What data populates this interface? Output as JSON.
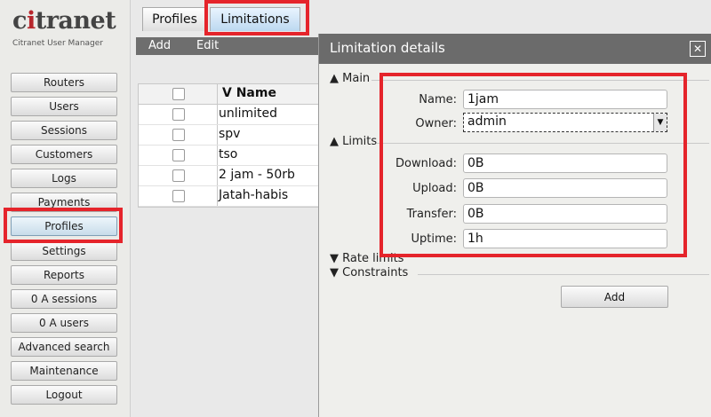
{
  "brand": {
    "logo_prefix": "c",
    "logo_accent": "i",
    "logo_suffix": "tranet",
    "subtitle": "Citranet User Manager"
  },
  "sidebar": {
    "items": [
      {
        "label": "Routers"
      },
      {
        "label": "Users"
      },
      {
        "label": "Sessions"
      },
      {
        "label": "Customers"
      },
      {
        "label": "Logs"
      },
      {
        "label": "Payments"
      },
      {
        "label": "Profiles",
        "active": true
      },
      {
        "label": "Settings"
      },
      {
        "label": "Reports"
      },
      {
        "label": "0 A sessions"
      },
      {
        "label": "0 A users"
      },
      {
        "label": "Advanced search"
      },
      {
        "label": "Maintenance"
      },
      {
        "label": "Logout"
      }
    ]
  },
  "tabs": [
    {
      "label": "Profiles"
    },
    {
      "label": "Limitations",
      "active": true
    }
  ],
  "toolbar": {
    "add_label": "Add",
    "edit_label": "Edit"
  },
  "list": {
    "header": "V Name",
    "rows": [
      "unlimited",
      "spv",
      "tso",
      "2 jam - 50rb",
      "Jatah-habis"
    ]
  },
  "dialog": {
    "title": "Limitation details",
    "close_icon": "close-icon",
    "main_section": "Main",
    "name_label": "Name:",
    "name_value": "1jam",
    "owner_label": "Owner:",
    "owner_value": "admin",
    "limits_section": "Limits",
    "download_label": "Download:",
    "download_value": "0B",
    "upload_label": "Upload:",
    "upload_value": "0B",
    "transfer_label": "Transfer:",
    "transfer_value": "0B",
    "uptime_label": "Uptime:",
    "uptime_value": "1h",
    "rate_limits_section": "Rate limits",
    "constraints_section": "Constraints",
    "add_label": "Add"
  },
  "colors": {
    "highlight": "#e5242b",
    "logo_red": "#b7262c",
    "dialog_title_bg": "#6b6b6b"
  }
}
